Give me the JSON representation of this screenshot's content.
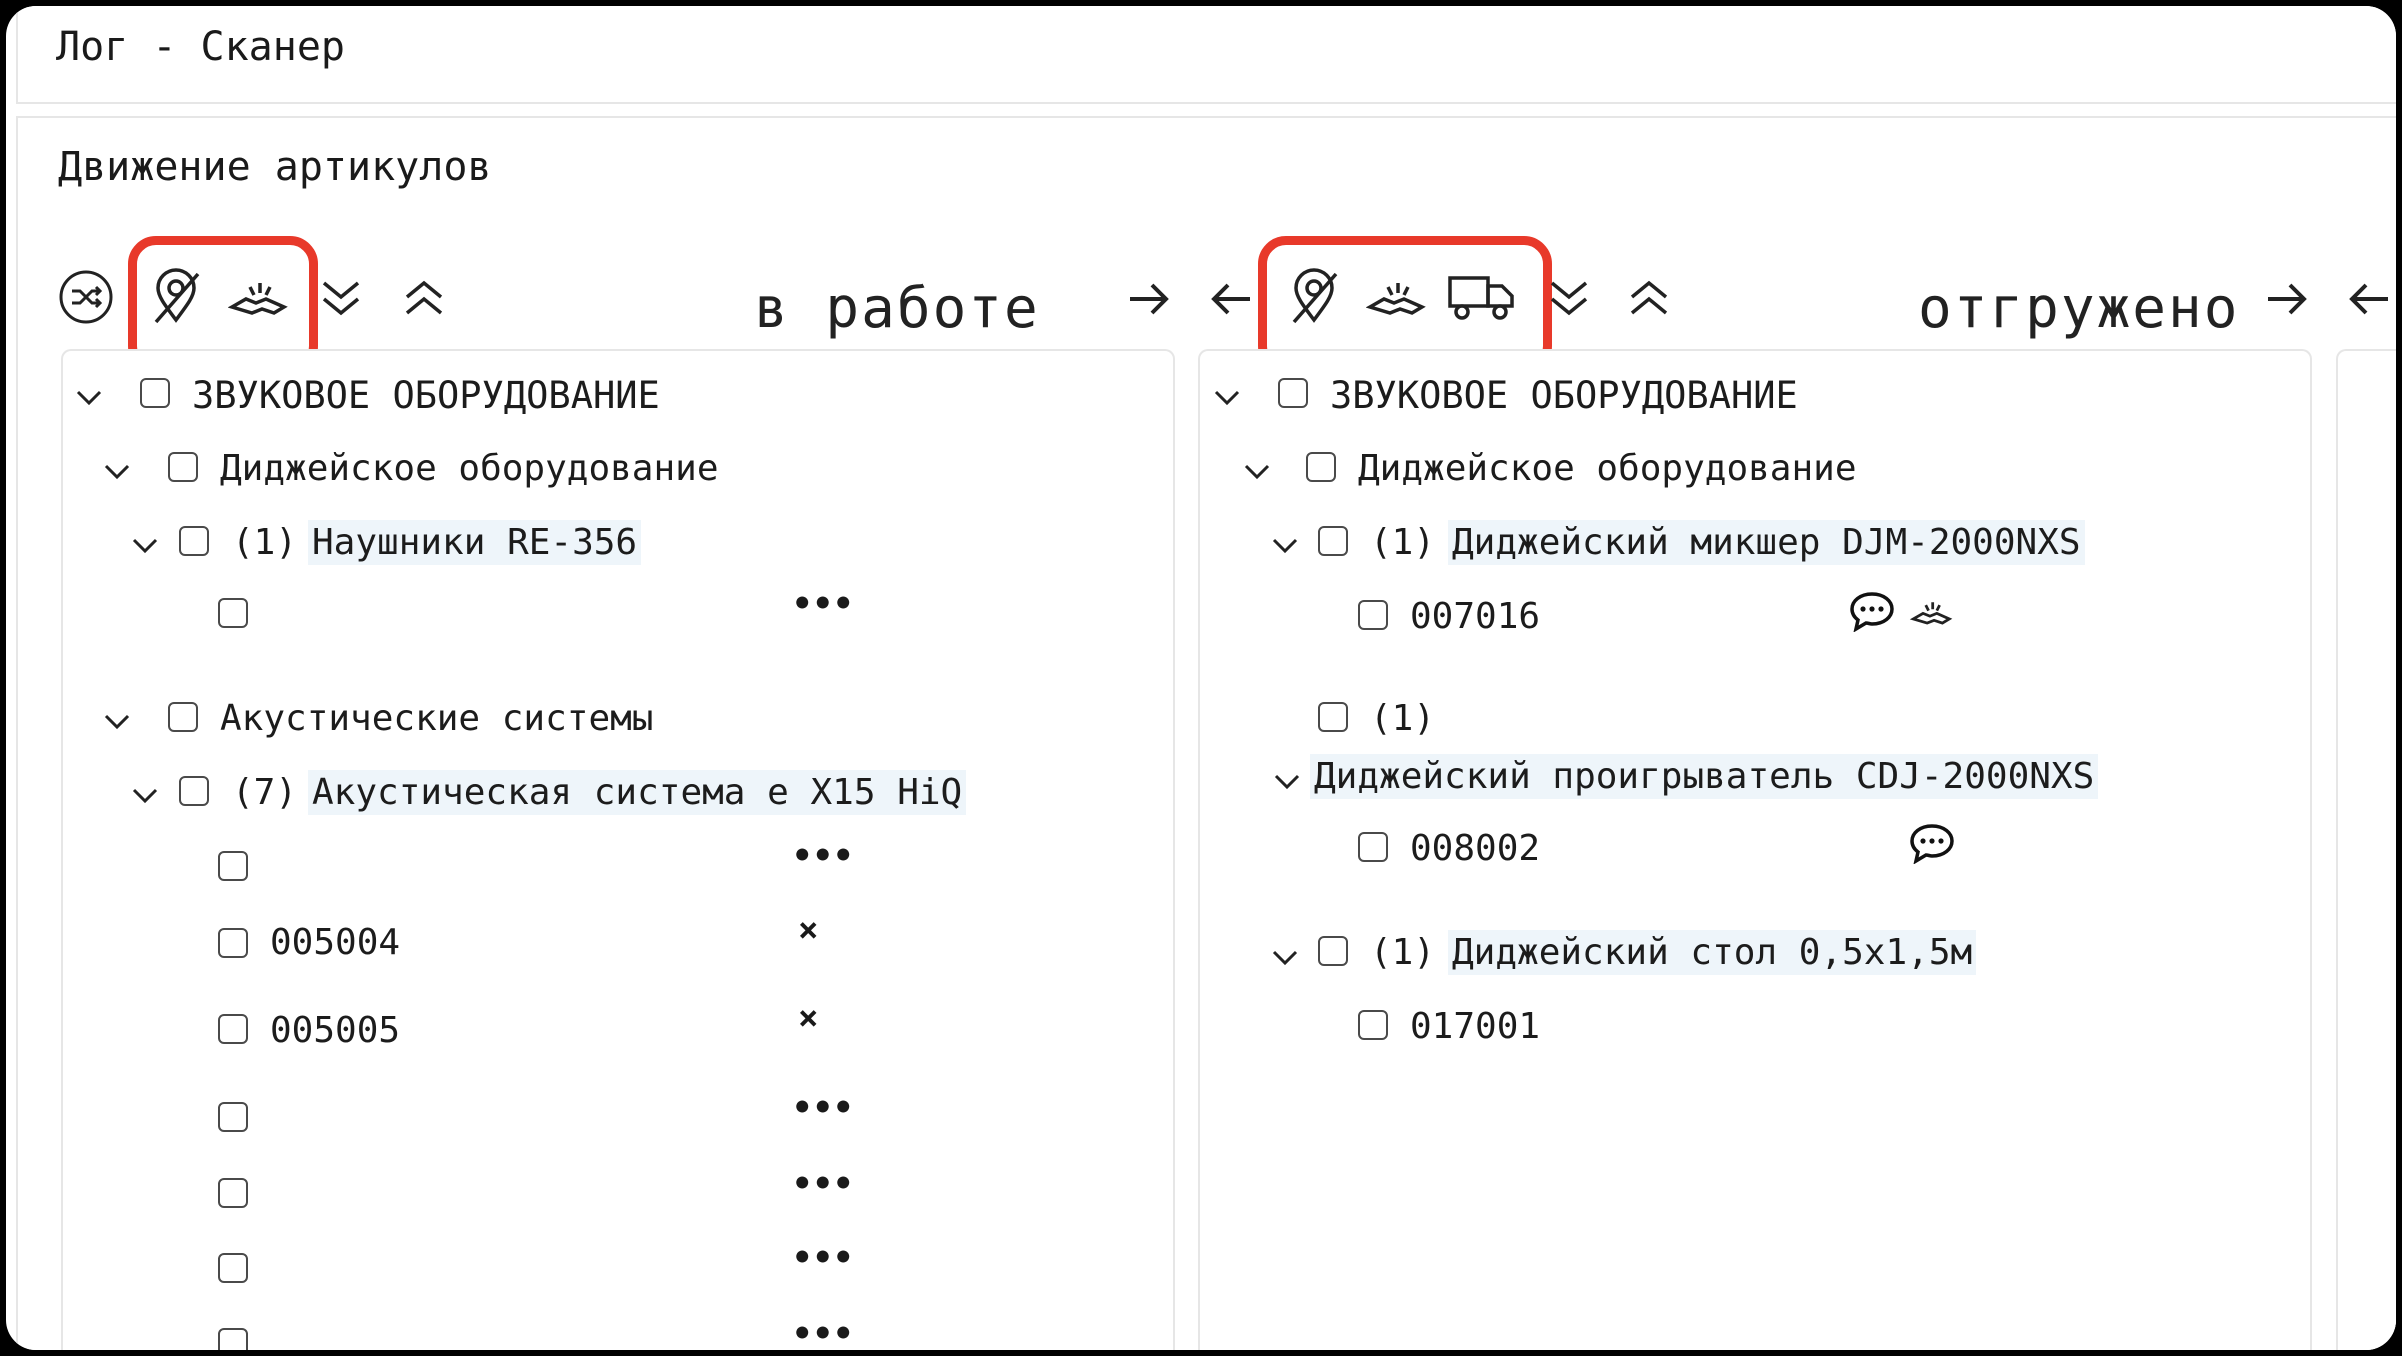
{
  "window": {
    "title": "Лог - Сканер"
  },
  "section": {
    "title": "Движение артикулов"
  },
  "columns": [
    {
      "status": "в работе",
      "tree": {
        "category": "ЗВУКОВОЕ ОБОРУДОВАНИЕ",
        "groups": [
          {
            "name": "Диджейское оборудование",
            "items": [
              {
                "count": "(1)",
                "name": "Наушники RE-356",
                "units": [
                  {
                    "code": "",
                    "mark": "•••"
                  }
                ]
              }
            ]
          },
          {
            "name": "Акустические системы",
            "items": [
              {
                "count": "(7)",
                "name": "Акустическая система e X15 HiQ",
                "units": [
                  {
                    "code": "",
                    "mark": "•••"
                  },
                  {
                    "code": "005004",
                    "mark": "×"
                  },
                  {
                    "code": "005005",
                    "mark": "×"
                  },
                  {
                    "code": "",
                    "mark": "•••"
                  },
                  {
                    "code": "",
                    "mark": "•••"
                  },
                  {
                    "code": "",
                    "mark": "•••"
                  },
                  {
                    "code": "",
                    "mark": "•••"
                  }
                ]
              }
            ]
          }
        ]
      }
    },
    {
      "status": "отгружено",
      "tree": {
        "category": "ЗВУКОВОЕ ОБОРУДОВАНИЕ",
        "groups": [
          {
            "name": "Диджейское оборудование",
            "items": [
              {
                "count": "(1)",
                "name": "Диджейский микшер DJM-2000NXS",
                "units": [
                  {
                    "code": "007016",
                    "icons": [
                      "comment-icon",
                      "handshake-icon"
                    ]
                  }
                ]
              },
              {
                "count": "(1)",
                "name": "Диджейский проигрыватель CDJ-2000NXS",
                "units": [
                  {
                    "code": "008002",
                    "icons": [
                      "comment-icon"
                    ]
                  }
                ]
              },
              {
                "count": "(1)",
                "name": "Диджейский стол 0,5x1,5м",
                "units": [
                  {
                    "code": "017001"
                  }
                ]
              }
            ]
          }
        ]
      }
    }
  ],
  "colors": {
    "highlight_border": "#e8392a",
    "item_highlight": "#eef5fa"
  }
}
